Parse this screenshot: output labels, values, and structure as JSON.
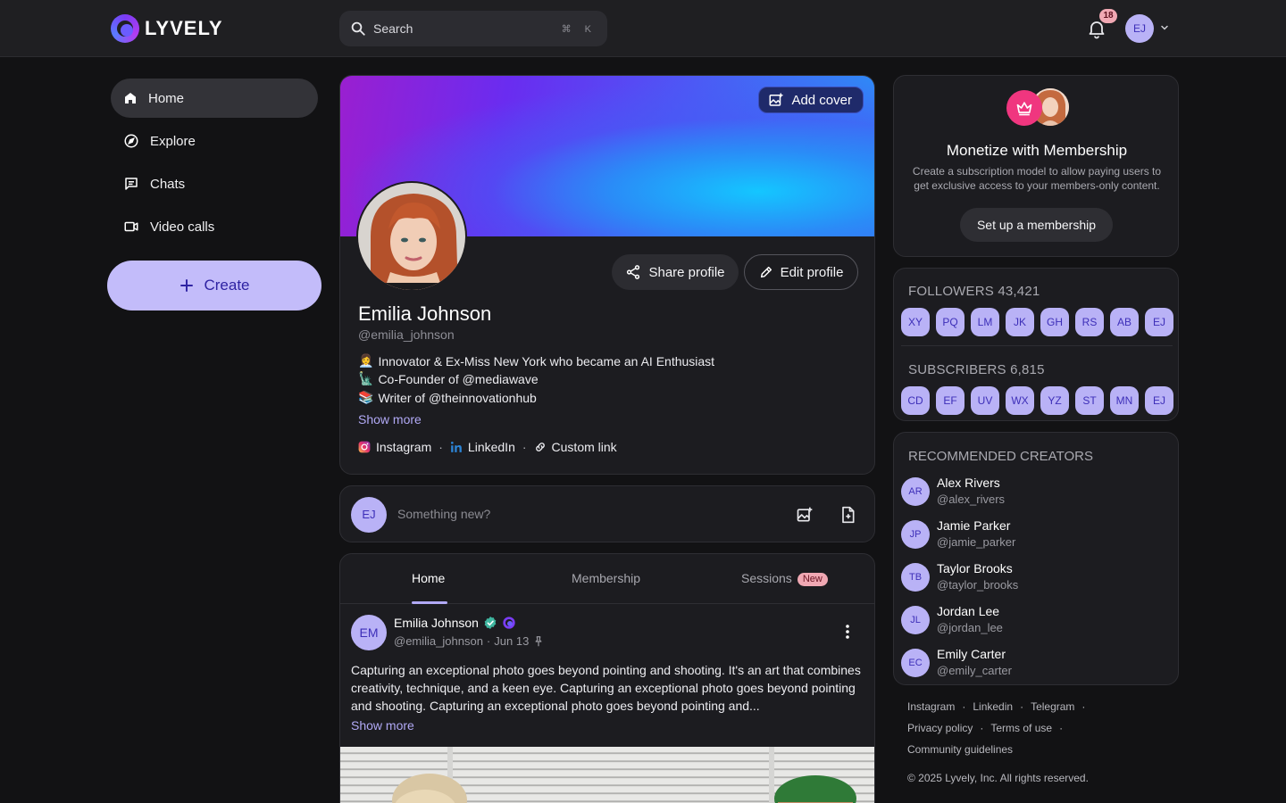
{
  "app": {
    "brand": "LYVELY"
  },
  "search": {
    "placeholder": "Search",
    "shortcut": "⌘ K"
  },
  "header": {
    "notifications_count": "18",
    "user_initials": "EJ"
  },
  "sidebar": {
    "items": [
      {
        "label": "Home",
        "icon": "home-icon",
        "active": true
      },
      {
        "label": "Explore",
        "icon": "compass-icon",
        "active": false
      },
      {
        "label": "Chats",
        "icon": "chat-icon",
        "active": false
      },
      {
        "label": "Video calls",
        "icon": "video-icon",
        "active": false
      }
    ],
    "create_label": "Create"
  },
  "profile": {
    "add_cover_label": "Add cover",
    "share_label": "Share profile",
    "edit_label": "Edit profile",
    "name": "Emilia Johnson",
    "handle": "@emilia_johnson",
    "bio": [
      {
        "emoji": "👩‍💼",
        "text": "Innovator & Ex-Miss New York who became an AI Enthusiast"
      },
      {
        "emoji": "🗽",
        "text": "Co-Founder of @mediawave"
      },
      {
        "emoji": "📚",
        "text": "Writer of @theinnovationhub"
      }
    ],
    "show_more": "Show more",
    "links": [
      {
        "label": "Instagram",
        "icon": "instagram-icon"
      },
      {
        "label": "LinkedIn",
        "icon": "linkedin-icon"
      },
      {
        "label": "Custom link",
        "icon": "link-icon"
      }
    ]
  },
  "composer": {
    "initials": "EJ",
    "placeholder": "Something new?"
  },
  "feed": {
    "tabs": [
      {
        "label": "Home",
        "active": true
      },
      {
        "label": "Membership",
        "active": false
      },
      {
        "label": "Sessions",
        "active": false,
        "badge": "New"
      }
    ],
    "post": {
      "initials": "EM",
      "author": "Emilia Johnson",
      "handle": "@emilia_johnson",
      "date": "Jun 13",
      "text": "Capturing an exceptional photo goes beyond pointing and shooting. It's an art that combines creativity, technique, and a keen eye. Capturing an exceptional photo goes beyond pointing and shooting. Capturing an exceptional photo goes beyond pointing and...",
      "show_more": "Show more"
    }
  },
  "promo": {
    "title": "Monetize with Membership",
    "description": "Create a subscription model to allow paying users to get exclusive access to your members-only content.",
    "button": "Set up a membership"
  },
  "followers": {
    "title": "FOLLOWERS 43,421",
    "chips": [
      "XY",
      "PQ",
      "LM",
      "JK",
      "GH",
      "RS",
      "AB",
      "EJ"
    ]
  },
  "subscribers": {
    "title": "SUBSCRIBERS 6,815",
    "chips": [
      "CD",
      "EF",
      "UV",
      "WX",
      "YZ",
      "ST",
      "MN",
      "EJ"
    ]
  },
  "recommended": {
    "title": "RECOMMENDED CREATORS",
    "creators": [
      {
        "initials": "AR",
        "name": "Alex Rivers",
        "handle": "@alex_rivers"
      },
      {
        "initials": "JP",
        "name": "Jamie Parker",
        "handle": "@jamie_parker"
      },
      {
        "initials": "TB",
        "name": "Taylor Brooks",
        "handle": "@taylor_brooks"
      },
      {
        "initials": "JL",
        "name": "Jordan Lee",
        "handle": "@jordan_lee"
      },
      {
        "initials": "EC",
        "name": "Emily Carter",
        "handle": "@emily_carter"
      }
    ]
  },
  "footer": {
    "row1": [
      "Instagram",
      "Linkedin",
      "Telegram"
    ],
    "row2": [
      "Privacy policy",
      "Terms of use"
    ],
    "row3": [
      "Community guidelines"
    ],
    "copyright": "© 2025 Lyvely, Inc. All rights reserved."
  },
  "colors": {
    "accent": "#b9b2f6",
    "background": "#121214",
    "card": "#1c1c20",
    "badge": "#f0a8b3"
  }
}
